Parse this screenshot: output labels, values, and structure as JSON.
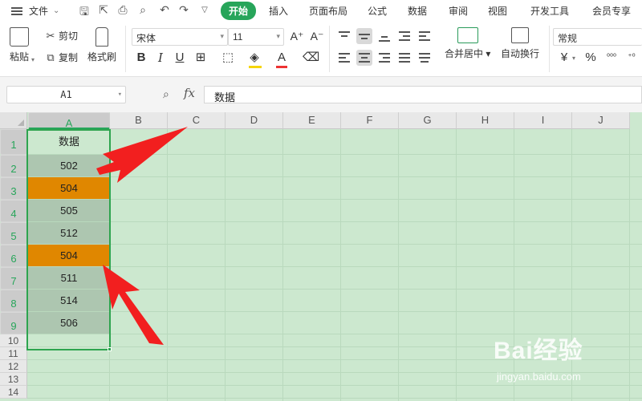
{
  "menubar": {
    "file_label": "文件",
    "tabs": [
      "开始",
      "插入",
      "页面布局",
      "公式",
      "数据",
      "审阅",
      "视图",
      "开发工具",
      "会员专享"
    ]
  },
  "ribbon": {
    "paste_label": "粘贴",
    "cut_label": "剪切",
    "copy_label": "复制",
    "format_painter_label": "格式刷",
    "font_name": "宋体",
    "font_size": "11",
    "merge_center_label": "合并居中",
    "wrap_text_label": "自动换行",
    "number_format": "常规",
    "currency_symbol": "¥",
    "percent_symbol": "%"
  },
  "formula_bar": {
    "cell_ref": "A1",
    "fx_label": "fx",
    "content": "数据"
  },
  "sheet": {
    "columns": [
      "A",
      "B",
      "C",
      "D",
      "E",
      "F",
      "G",
      "H",
      "I",
      "J"
    ],
    "rows": [
      "1",
      "2",
      "3",
      "4",
      "5",
      "6",
      "7",
      "8",
      "9",
      "10",
      "11",
      "12",
      "13",
      "14"
    ],
    "cells": [
      {
        "value": "数据",
        "style": "header"
      },
      {
        "value": "502",
        "style": "grey"
      },
      {
        "value": "504",
        "style": "orange"
      },
      {
        "value": "505",
        "style": "grey"
      },
      {
        "value": "512",
        "style": "grey"
      },
      {
        "value": "504",
        "style": "orange"
      },
      {
        "value": "511",
        "style": "grey"
      },
      {
        "value": "514",
        "style": "grey"
      },
      {
        "value": "506",
        "style": "grey"
      }
    ],
    "highlight_color": "#e08700",
    "selection_color": "#2ea44f",
    "sheet_background": "#cce8cf"
  },
  "watermark": {
    "brand": "Bai经验",
    "url": "jingyan.baidu.com"
  },
  "colors": {
    "accent": "#27a55a",
    "arrow": "#f21f1f"
  }
}
